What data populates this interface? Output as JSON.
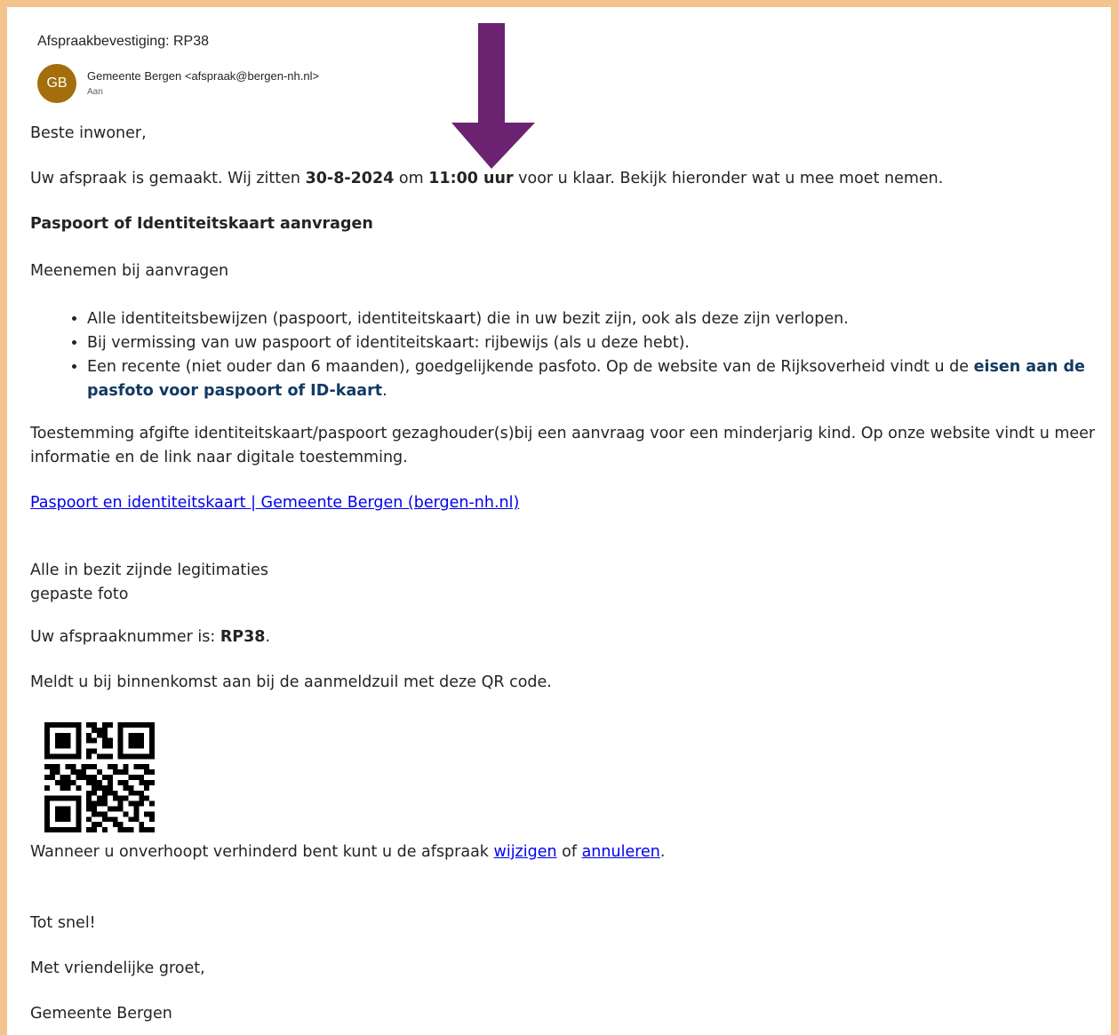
{
  "email": {
    "subject": "Afspraakbevestiging: RP38",
    "avatar_initials": "GB",
    "avatar_color": "#a36e0b",
    "sender": "Gemeente Bergen <afspraak@bergen-nh.nl>",
    "to_label": "Aan"
  },
  "body": {
    "greeting": "Beste inwoner,",
    "confirm_pre": "Uw afspraak is gemaakt. Wij zitten ",
    "confirm_date": "30-8-2024",
    "confirm_mid": " om ",
    "confirm_time": "11:00 uur",
    "confirm_post": " voor u klaar. Bekijk hieronder wat u mee moet nemen.",
    "section_heading": "Paspoort of Identiteitskaart aanvragen",
    "bring_label": "Meenemen bij aanvragen",
    "bullet_1": "Alle identiteitsbewijzen (paspoort, identiteitskaart) die in uw bezit zijn, ook als deze zijn verlopen.",
    "bullet_2": "Bij vermissing van uw paspoort of identiteitskaart: rijbewijs (als u deze hebt).",
    "bullet_3_pre": "Een recente (niet ouder dan 6 maanden), goedgelijkende pasfoto. Op de website van de Rijksoverheid vindt u de ",
    "bullet_3_link": "eisen aan de pasfoto voor paspoort of ID-kaart",
    "bullet_3_post": ".",
    "consent_text": "Toestemming afgifte identiteitskaart/paspoort gezaghouder(s)bij een aanvraag voor een minderjarig kind. Op onze website vindt u meer informatie en de link naar digitale toestemming.",
    "info_link": "Paspoort en identiteitskaart | Gemeente Bergen (bergen-nh.nl)",
    "extra_line_1": "Alle in bezit zijnde legitimaties",
    "extra_line_2": "gepaste foto",
    "appt_pre": "Uw afspraaknummer is: ",
    "appt_number": "RP38",
    "appt_post": ".",
    "checkin_text": "Meldt u bij binnenkomst aan bij de aanmeldzuil met deze QR code.",
    "change_pre": "Wanneer u onverhoopt verhinderd bent kunt u de afspraak ",
    "change_link": "wijzigen",
    "change_mid": " of ",
    "cancel_link": "annuleren",
    "change_post": ".",
    "closing_1": "Tot snel!",
    "closing_2": "Met vriendelijke groet,",
    "signature": "Gemeente Bergen"
  },
  "annotation": {
    "arrow_icon": "down-arrow-icon",
    "arrow_color": "#6b2371"
  }
}
